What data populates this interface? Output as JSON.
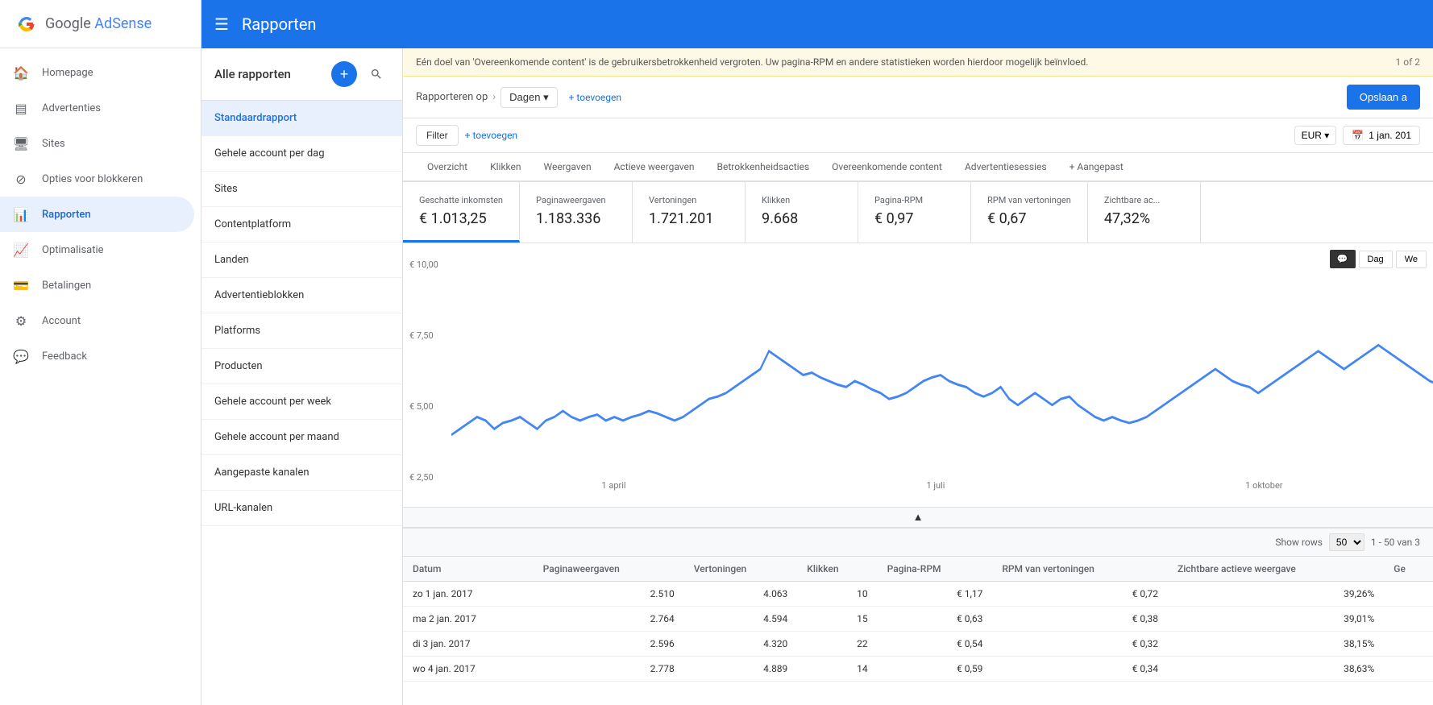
{
  "app": {
    "logo_google": "G",
    "logo_product": "AdSense"
  },
  "sidebar": {
    "items": [
      {
        "id": "homepage",
        "label": "Homepage",
        "icon": "🏠"
      },
      {
        "id": "advertenties",
        "label": "Advertenties",
        "icon": "☰"
      },
      {
        "id": "sites",
        "label": "Sites",
        "icon": "🖥"
      },
      {
        "id": "opties",
        "label": "Opties voor blokkeren",
        "icon": "⊘"
      },
      {
        "id": "rapporten",
        "label": "Rapporten",
        "icon": "📊",
        "active": true
      },
      {
        "id": "optimalisatie",
        "label": "Optimalisatie",
        "icon": "📈"
      },
      {
        "id": "betalingen",
        "label": "Betalingen",
        "icon": "💳"
      },
      {
        "id": "account",
        "label": "Account",
        "icon": "⚙"
      },
      {
        "id": "feedback",
        "label": "Feedback",
        "icon": "💬"
      }
    ]
  },
  "topbar": {
    "menu_icon": "☰",
    "title": "Rapporten"
  },
  "reports_panel": {
    "title": "Alle rapporten",
    "add_icon": "+",
    "search_icon": "🔍",
    "items": [
      {
        "label": "Standaardrapport",
        "active": true
      },
      {
        "label": "Gehele account per dag"
      },
      {
        "label": "Sites"
      },
      {
        "label": "Contentplatform"
      },
      {
        "label": "Landen"
      },
      {
        "label": "Advertentieblokken"
      },
      {
        "label": "Platforms"
      },
      {
        "label": "Producten"
      },
      {
        "label": "Gehele account per week"
      },
      {
        "label": "Gehele account per maand"
      },
      {
        "label": "Aangepaste kanalen"
      },
      {
        "label": "URL-kanalen"
      }
    ]
  },
  "banner": {
    "text": "Eén doel van 'Overeenkomende content' is de gebruikersbetrokkenheid vergroten. Uw pagina-RPM en andere statistieken worden hierdoor mogelijk beïnvloed.",
    "page": "1 of 2"
  },
  "report_toolbar": {
    "breadcrumb_label": "Rapporteren op",
    "breadcrumb_chevron": "›",
    "period": "Dagen",
    "period_dropdown": "▾",
    "add_label": "+ toevoegen",
    "save_label": "Opslaan a"
  },
  "filter_bar": {
    "filter_label": "Filter",
    "add_filter": "+ toevoegen",
    "currency": "EUR",
    "currency_dropdown": "▾",
    "calendar_icon": "📅",
    "date": "1 jan. 201"
  },
  "tabs": [
    {
      "label": "Overzicht",
      "active": false
    },
    {
      "label": "Klikken",
      "active": false
    },
    {
      "label": "Weergaven",
      "active": false
    },
    {
      "label": "Actieve weergaven",
      "active": false
    },
    {
      "label": "Betrokkenheidsacties",
      "active": false
    },
    {
      "label": "Overeenkomende content",
      "active": false
    },
    {
      "label": "Advertentiesessies",
      "active": false
    },
    {
      "label": "+ Aangepast",
      "active": false
    }
  ],
  "metrics": [
    {
      "label": "Geschatte inkomsten",
      "value": "€ 1.013,25",
      "selected": true
    },
    {
      "label": "Paginaweergaven",
      "value": "1.183.336"
    },
    {
      "label": "Vertoningen",
      "value": "1.721.201"
    },
    {
      "label": "Klikken",
      "value": "9.668"
    },
    {
      "label": "Pagina-RPM",
      "value": "€ 0,97"
    },
    {
      "label": "RPM van vertoningen",
      "value": "€ 0,67"
    },
    {
      "label": "Zichtbare ac...",
      "value": "47,32%"
    }
  ],
  "chart": {
    "y_labels": [
      "€ 10,00",
      "€ 7,50",
      "€ 5,00",
      "€ 2,50"
    ],
    "x_labels": [
      "1 april",
      "1 juli",
      "1 oktober"
    ],
    "dag_btn": "Dag",
    "week_btn": "We",
    "accent_color": "#4285f4"
  },
  "table": {
    "show_rows_label": "Show rows",
    "rows_options": [
      "50"
    ],
    "rows_count": "1 - 50 van 3",
    "columns": [
      "Datum",
      "Paginaweergaven",
      "Vertoningen",
      "Klikken",
      "Pagina-RPM",
      "RPM van vertoningen",
      "Zichtbare actieve weergave",
      "Ge"
    ],
    "rows": [
      {
        "datum": "zo 1 jan. 2017",
        "paginaweergaven": "2.510",
        "vertoningen": "4.063",
        "klikken": "10",
        "paginarpm": "€ 1,17",
        "rpmvertoningen": "€ 0,72",
        "zichtbaar": "39,26%"
      },
      {
        "datum": "ma 2 jan. 2017",
        "paginaweergaven": "2.764",
        "vertoningen": "4.594",
        "klikken": "15",
        "paginarpm": "€ 0,63",
        "rpmvertoningen": "€ 0,38",
        "zichtbaar": "39,01%"
      },
      {
        "datum": "di 3 jan. 2017",
        "paginaweergaven": "2.596",
        "vertoningen": "4.320",
        "klikken": "22",
        "paginarpm": "€ 0,54",
        "rpmvertoningen": "€ 0,32",
        "zichtbaar": "38,15%"
      },
      {
        "datum": "wo 4 jan. 2017",
        "paginaweergaven": "2.778",
        "vertoningen": "4.889",
        "klikken": "14",
        "paginarpm": "€ 0,59",
        "rpmvertoningen": "€ 0,34",
        "zichtbaar": "38,63%"
      }
    ]
  }
}
